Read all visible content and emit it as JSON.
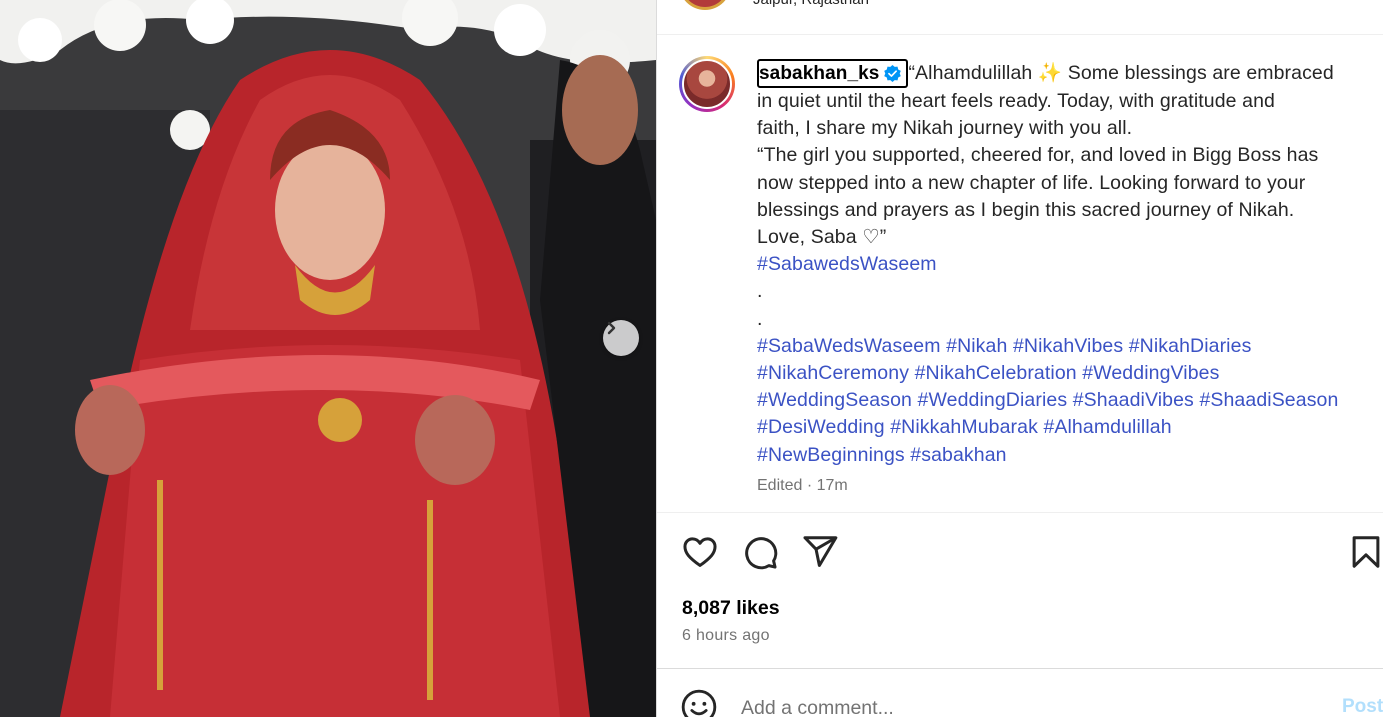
{
  "post": {
    "location": "Jaipur, Rajasthan",
    "image_alt": "Bride in red bridal lehenga walking under a floral canopy",
    "carousel_next": "next"
  },
  "caption": {
    "username": "sabakhan_ks",
    "verified": true,
    "lines": [
      "“Alhamdulillah ✨ Some blessings are embraced",
      "in quiet until the heart feels ready. Today, with gratitude and",
      "faith, I share my Nikah journey with you all.",
      "“The girl you supported, cheered for, and loved in Bigg Boss has",
      "now stepped into a new chapter of life. Looking forward to your",
      "blessings and prayers as I begin this sacred journey of Nikah.",
      "Love, Saba ♡”"
    ],
    "tag_line_1": "#SabawedsWaseem",
    "dot_1": ".",
    "dot_2": ".",
    "hashtag_lines": [
      [
        "#SabaWedsWaseem",
        "#Nikah",
        "#NikahVibes",
        "#NikahDiaries"
      ],
      [
        "#NikahCeremony",
        "#NikahCelebration",
        "#WeddingVibes"
      ],
      [
        "#WeddingSeason",
        "#WeddingDiaries",
        "#ShaadiVibes",
        "#ShaadiSeason"
      ],
      [
        "#DesiWedding",
        "#NikkahMubarak",
        "#Alhamdulillah"
      ],
      [
        "#NewBeginnings",
        "#sabakhan"
      ]
    ],
    "edited": "Edited · 17m"
  },
  "actions": {
    "like": "heart-icon",
    "comment": "comment-icon",
    "share": "share-icon",
    "save": "bookmark-icon"
  },
  "stats": {
    "likes": "8,087 likes",
    "time_ago": "6 hours ago"
  },
  "comment_box": {
    "placeholder": "Add a comment...",
    "post_label": "Post"
  },
  "colors": {
    "hashtag": "#3b52c4",
    "verified": "#0095f6",
    "post_disabled": "#b2dffc"
  }
}
